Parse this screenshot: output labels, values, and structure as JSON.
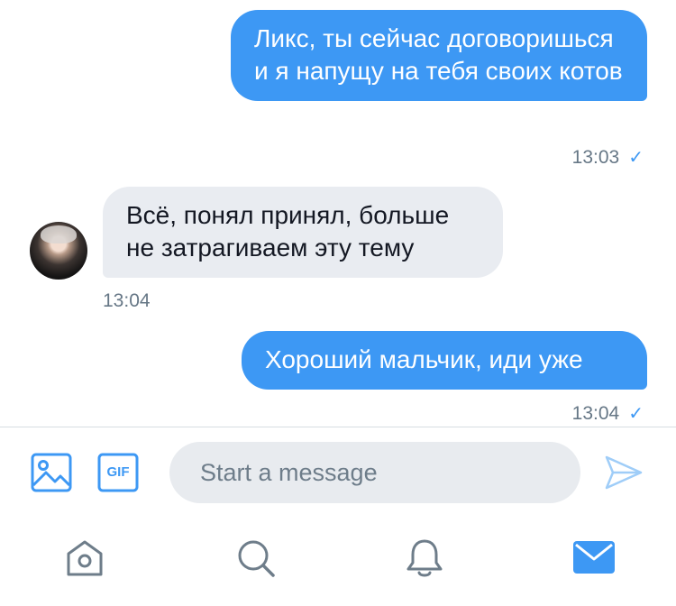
{
  "messages": [
    {
      "direction": "sent",
      "text": "Ликс, ты сейчас договоришься и я напущу на тебя своих котов",
      "time": "13:03",
      "status_icon": "check-icon"
    },
    {
      "direction": "received",
      "text": "Всё, понял принял, больше не затрагиваем эту тему",
      "time": "13:04",
      "avatar_icon": "avatar-photo"
    },
    {
      "direction": "sent",
      "text": "Хороший мальчик, иди уже",
      "time": "13:04",
      "status_icon": "check-icon"
    }
  ],
  "composer": {
    "placeholder": "Start a message",
    "gif_label": "GIF",
    "icons": [
      "image-icon",
      "gif-icon",
      "send-icon"
    ]
  },
  "tab_bar": {
    "items": [
      {
        "name": "home",
        "icon": "home-icon",
        "active": false
      },
      {
        "name": "search",
        "icon": "search-icon",
        "active": false
      },
      {
        "name": "notifications",
        "icon": "bell-icon",
        "active": false
      },
      {
        "name": "messages",
        "icon": "mail-icon",
        "active": true
      }
    ]
  },
  "colors": {
    "accent": "#3d98f4",
    "sent_bubble": "#3d98f4",
    "received_bubble": "#e9ecf1",
    "timestamp": "#667786",
    "inactive_icon": "#6e7d8a",
    "send_icon_disabled": "#9fcdf8"
  }
}
